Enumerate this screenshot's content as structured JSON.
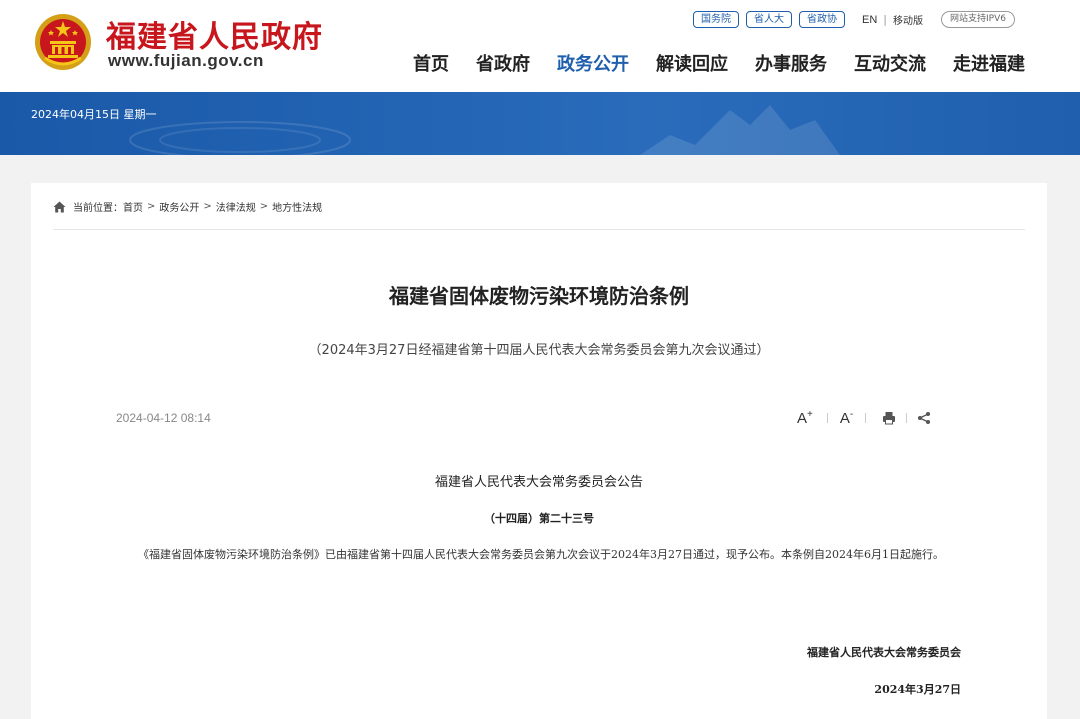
{
  "header": {
    "site_name": "福建省人民政府",
    "site_url": "www.fujian.gov.cn",
    "top_links": [
      "国务院",
      "省人大",
      "省政协"
    ],
    "lang_en": "EN",
    "lang_sep": "|",
    "mobile": "移动版",
    "ipv6": "网站支持IPV6",
    "nav": [
      "首页",
      "省政府",
      "政务公开",
      "解读回应",
      "办事服务",
      "互动交流",
      "走进福建"
    ],
    "nav_active_index": 2
  },
  "banner": {
    "date": "2024年04月15日 星期一"
  },
  "breadcrumb": {
    "prefix": "当前位置：",
    "items": [
      "首页",
      "政务公开",
      "法律法规",
      "地方性法规"
    ],
    "separator": ">"
  },
  "article": {
    "title": "福建省固体废物污染环境防治条例",
    "subtitle": "（2024年3月27日经福建省第十四届人民代表大会常务委员会第九次会议通过）",
    "publish_time": "2024-04-12 08:14",
    "tools": {
      "font_increase": "A",
      "font_decrease": "A",
      "plus": "+",
      "minus": "-"
    },
    "announcement_heading": "福建省人民代表大会常务委员会公告",
    "announcement_number": "（十四届）第二十三号",
    "body": "《福建省固体废物污染环境防治条例》已由福建省第十四届人民代表大会常务委员会第九次会议于2024年3月27日通过，现予公布。本条例自2024年6月1日起施行。",
    "signature": "福建省人民代表大会常务委员会",
    "sign_date": "2024年3月27日"
  },
  "colors": {
    "brand_red": "#c8161d",
    "brand_blue": "#1f5fad",
    "banner": "#1f5fad"
  },
  "icons": [
    "national-emblem-icon",
    "home-icon",
    "print-icon",
    "share-icon"
  ]
}
